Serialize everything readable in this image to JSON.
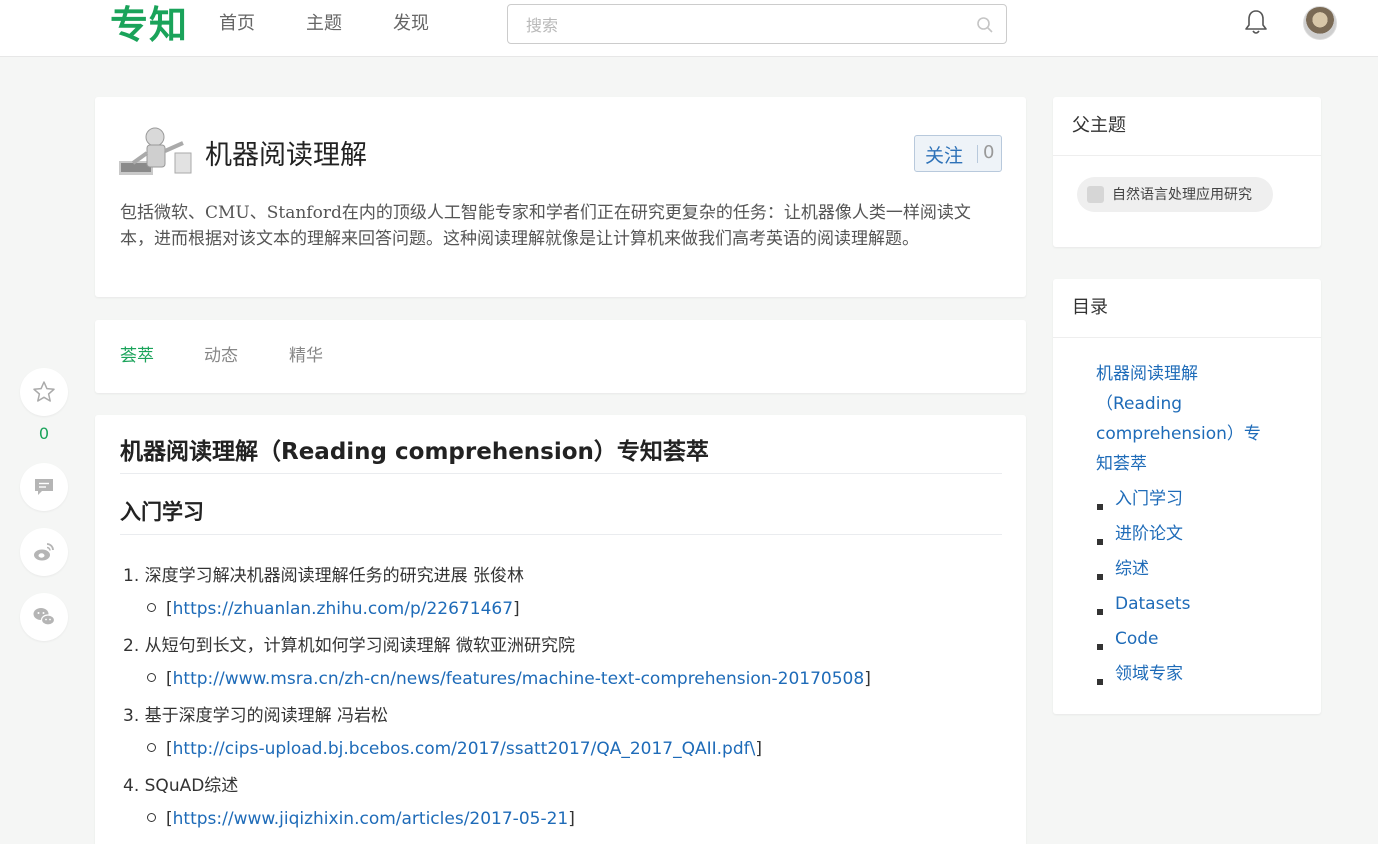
{
  "header": {
    "logo": "专知",
    "nav": [
      "首页",
      "主题",
      "发现"
    ],
    "search_placeholder": "搜索",
    "icons": [
      "search-icon",
      "bell-icon",
      "avatar"
    ]
  },
  "topic": {
    "title": "机器阅读理解",
    "follow_label": "关注",
    "follow_count": "0",
    "description": "包括微软、CMU、Stanford在内的顶级人工智能专家和学者们正在研究更复杂的任务：让机器像人类一样阅读文本，进而根据对该文本的理解来回答问题。这种阅读理解就像是让计算机来做我们高考英语的阅读理解题。"
  },
  "tabs": [
    {
      "label": "荟萃",
      "active": true
    },
    {
      "label": "动态",
      "active": false
    },
    {
      "label": "精华",
      "active": false
    }
  ],
  "article": {
    "title": "机器阅读理解（Reading comprehension）专知荟萃",
    "section": "入门学习",
    "items": [
      {
        "num": "1.",
        "text": "深度学习解决机器阅读理解任务的研究进展 张俊林",
        "link": "https://zhuanlan.zhihu.com/p/22671467",
        "suffix": "]"
      },
      {
        "num": "2.",
        "text": "从短句到长文，计算机如何学习阅读理解 微软亚洲研究院",
        "link": "http://www.msra.cn/zh-cn/news/features/machine-text-comprehension-20170508",
        "suffix": "]"
      },
      {
        "num": "3.",
        "text": "基于深度学习的阅读理解 冯岩松",
        "link": "http://cips-upload.bj.bcebos.com/2017/ssatt2017/QA_2017_QAII.pdf\\",
        "suffix": "]"
      },
      {
        "num": "4.",
        "text": "SQuAD综述",
        "link": "https://www.jiqizhixin.com/articles/2017-05-21",
        "suffix": "]"
      }
    ]
  },
  "share": {
    "star_count": "0",
    "icons": [
      "star-icon",
      "comment-icon",
      "weibo-icon",
      "wechat-icon"
    ]
  },
  "sidebar": {
    "parent_heading": "父主题",
    "parent_topic": "自然语言处理应用研究",
    "toc_heading": "目录",
    "toc_main": "机器阅读理解（Reading comprehension）专知荟萃",
    "toc_items": [
      "入门学习",
      "进阶论文",
      "综述",
      "Datasets",
      "Code",
      "领域专家"
    ]
  },
  "colors": {
    "brand_green": "#1aa35a",
    "link_blue": "#1e6bb8"
  }
}
